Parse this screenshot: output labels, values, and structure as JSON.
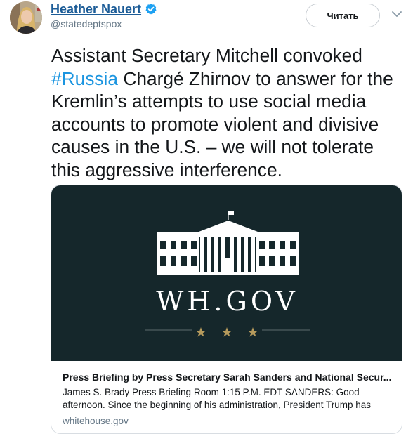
{
  "author": {
    "display_name": "Heather Nauert",
    "handle": "@statedeptspox",
    "verified": true
  },
  "follow_button_label": "Читать",
  "tweet": {
    "text_before_hashtag": "Assistant Secretary Mitchell convoked ",
    "hashtag": "#Russia",
    "text_after_hashtag": " Chargé Zhirnov to answer for the Kremlin’s attempts to use social media accounts to promote violent and divisive causes in the U.S. – we will not tolerate this aggressive interference."
  },
  "card": {
    "image": {
      "logo_text": "WH.GOV",
      "icon": "white-house-icon",
      "stars_count": 3,
      "background_color": "#15272b",
      "star_color": "#b59a5c"
    },
    "title": "Press Briefing by Press Secretary Sarah Sanders and National Secur...",
    "description": "James S. Brady Press Briefing Room 1:15 P.M. EDT SANDERS:   Good afternoon.  Since the beginning of his administration, President Trump has",
    "domain": "whitehouse.gov"
  },
  "colors": {
    "name_link": "#1c5c97",
    "hashtag": "#1b95e0",
    "verified_badge": "#1da1f2",
    "secondary_text": "#657786"
  }
}
